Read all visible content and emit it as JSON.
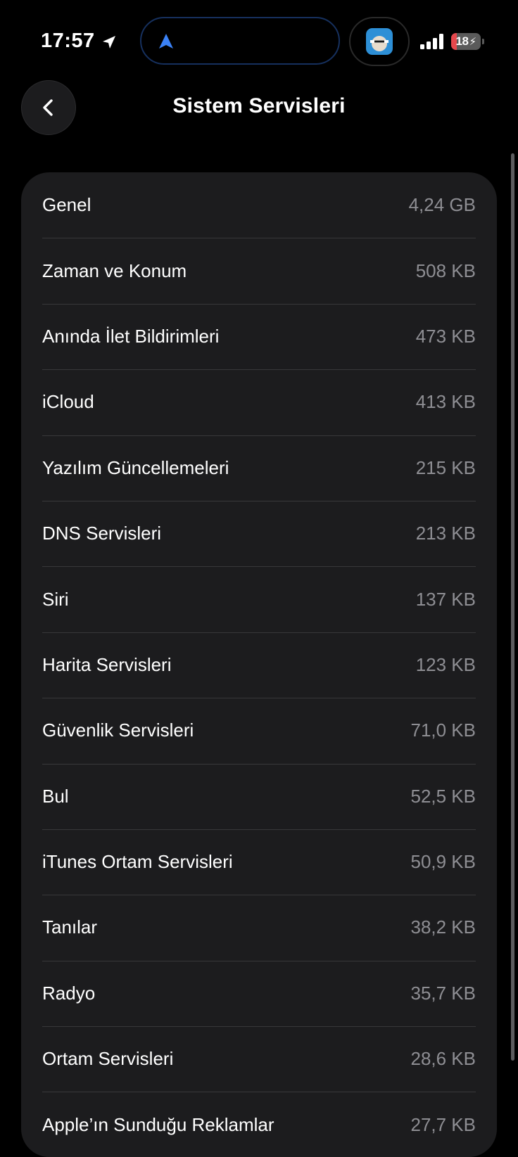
{
  "status_bar": {
    "time": "17:57",
    "battery_level": "18",
    "battery_color": "#e5484d",
    "battery_fraction": 0.18,
    "icons": [
      "location-arrow-icon",
      "navigation-arrow-icon",
      "app-thumbnail",
      "cellular-signal-icon",
      "battery-icon",
      "charging-bolt-icon"
    ]
  },
  "header": {
    "title": "Sistem Servisleri",
    "back_icon": "chevron-left-icon"
  },
  "services": [
    {
      "name": "Genel",
      "size": "4,24 GB"
    },
    {
      "name": "Zaman ve Konum",
      "size": "508 KB"
    },
    {
      "name": "Anında İlet Bildirimleri",
      "size": "473 KB"
    },
    {
      "name": "iCloud",
      "size": "413 KB"
    },
    {
      "name": "Yazılım Güncellemeleri",
      "size": "215 KB"
    },
    {
      "name": "DNS Servisleri",
      "size": "213 KB"
    },
    {
      "name": "Siri",
      "size": "137 KB"
    },
    {
      "name": "Harita Servisleri",
      "size": "123 KB"
    },
    {
      "name": "Güvenlik Servisleri",
      "size": "71,0 KB"
    },
    {
      "name": "Bul",
      "size": "52,5 KB"
    },
    {
      "name": "iTunes Ortam Servisleri",
      "size": "50,9 KB"
    },
    {
      "name": "Tanılar",
      "size": "38,2 KB"
    },
    {
      "name": "Radyo",
      "size": "35,7 KB"
    },
    {
      "name": "Ortam Servisleri",
      "size": "28,6 KB"
    },
    {
      "name": "Apple’ın Sunduğu Reklamlar",
      "size": "27,7 KB"
    }
  ],
  "colors": {
    "background": "#000000",
    "card": "#1c1c1e",
    "separator": "#38383a",
    "secondary_text": "#8e8e93",
    "accent": "#3b82f6"
  }
}
